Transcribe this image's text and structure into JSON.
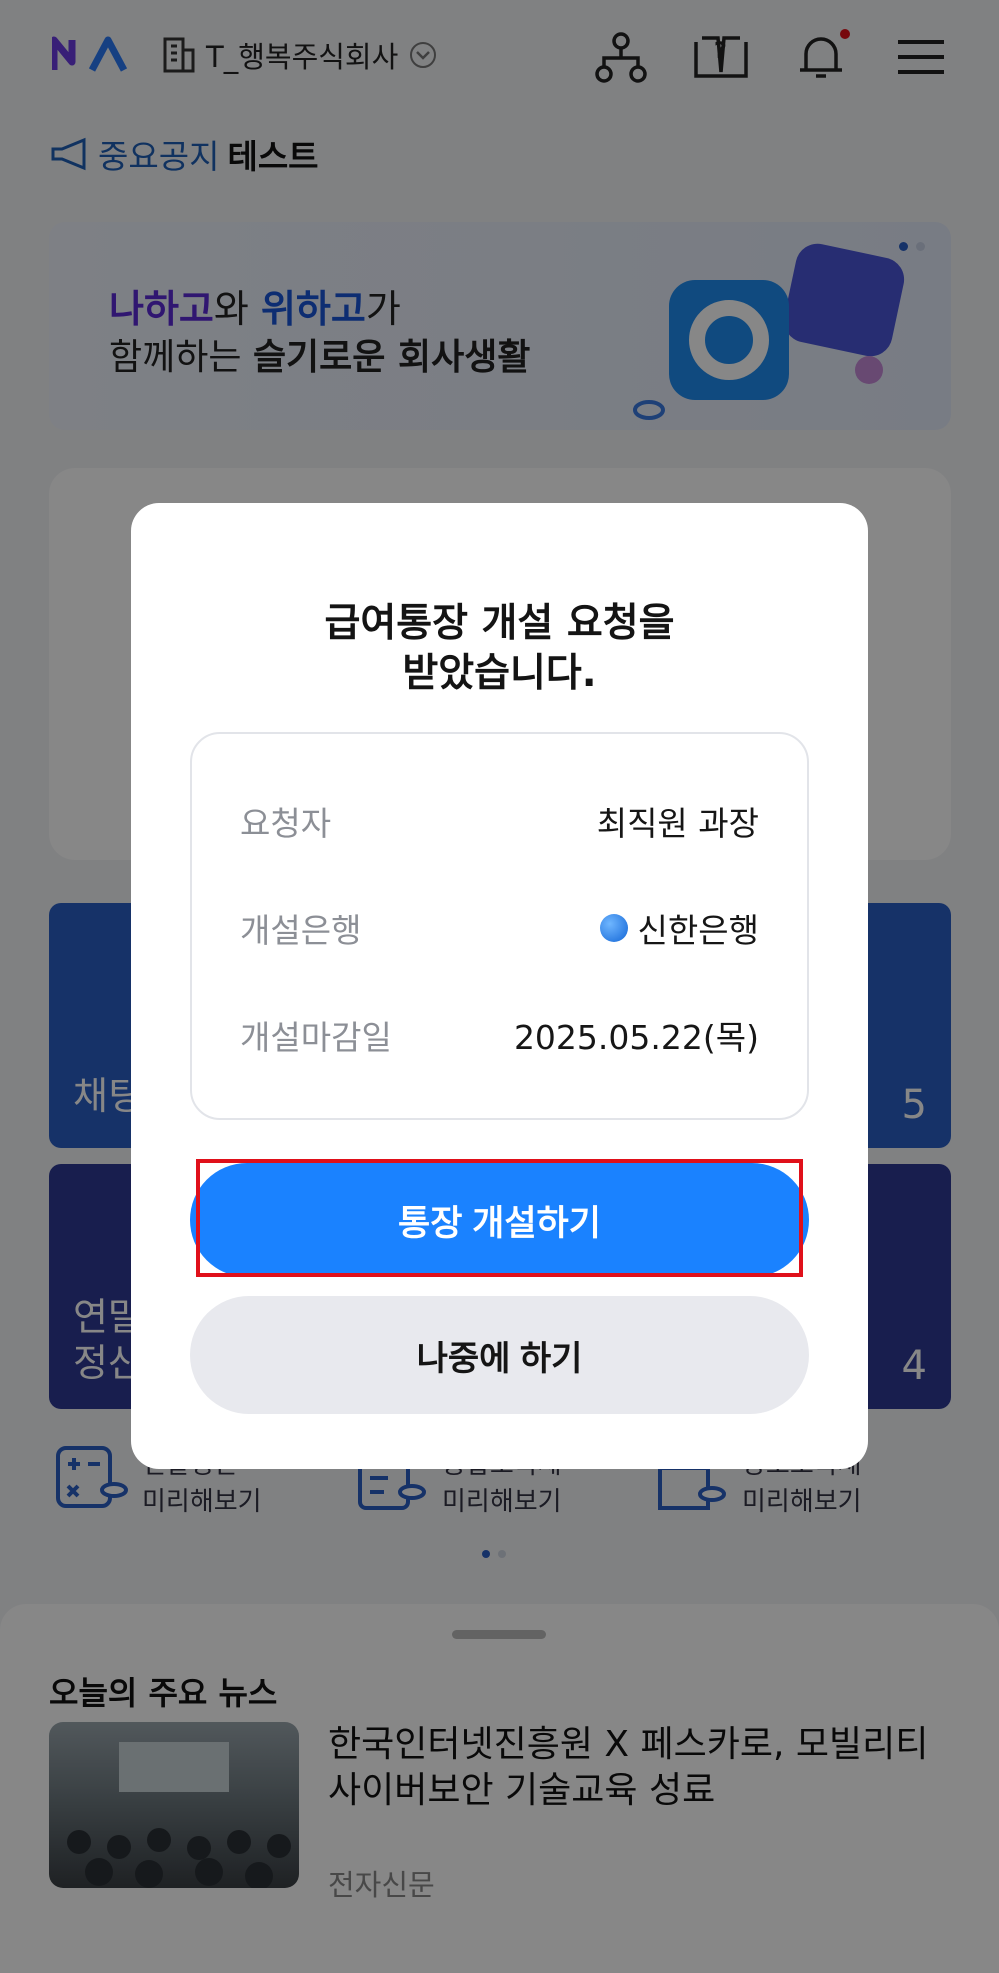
{
  "header": {
    "logo_text": "NA",
    "company_name": "T_행복주식회사",
    "icons": [
      "org-chart-icon",
      "help-book-icon",
      "bell-icon",
      "menu-icon"
    ],
    "notification_dot_color": "#e0101a"
  },
  "notice": {
    "label": "중요공지",
    "text": "테스트"
  },
  "banner": {
    "line1_a": "나하고",
    "line1_b": "와 ",
    "line1_c": "위하고",
    "line1_d": "가",
    "line2_a": "함께하는 ",
    "line2_b": "슬기로운 회사생활"
  },
  "tiles": [
    {
      "label": "채팅",
      "count": "5",
      "color": "#2a5fc4"
    },
    {
      "label": "연말\n정산",
      "count": "4",
      "color": "#2e3a94"
    }
  ],
  "quick_links": [
    {
      "line1": "연말정산",
      "line2": "미리해보기"
    },
    {
      "line1": "종합소득세",
      "line2": "미리해보기"
    },
    {
      "line1": "양도소득세",
      "line2": "미리해보기"
    }
  ],
  "news": {
    "heading": "오늘의 주요 뉴스",
    "title": "한국인터넷진흥원 X 페스카로, 모빌리티 사이버보안 기술교육 성료",
    "source": "전자신문"
  },
  "modal": {
    "title_line1": "급여통장 개설 요청을",
    "title_line2": "받았습니다.",
    "rows": [
      {
        "key": "요청자",
        "value": "최직원 과장"
      },
      {
        "key": "개설은행",
        "value": "신한은행",
        "icon": "shinhan-bank-icon"
      },
      {
        "key": "개설마감일",
        "value": "2025.05.22(목)"
      }
    ],
    "primary_button": "통장 개설하기",
    "secondary_button": "나중에 하기",
    "primary_color": "#1a82ff"
  }
}
